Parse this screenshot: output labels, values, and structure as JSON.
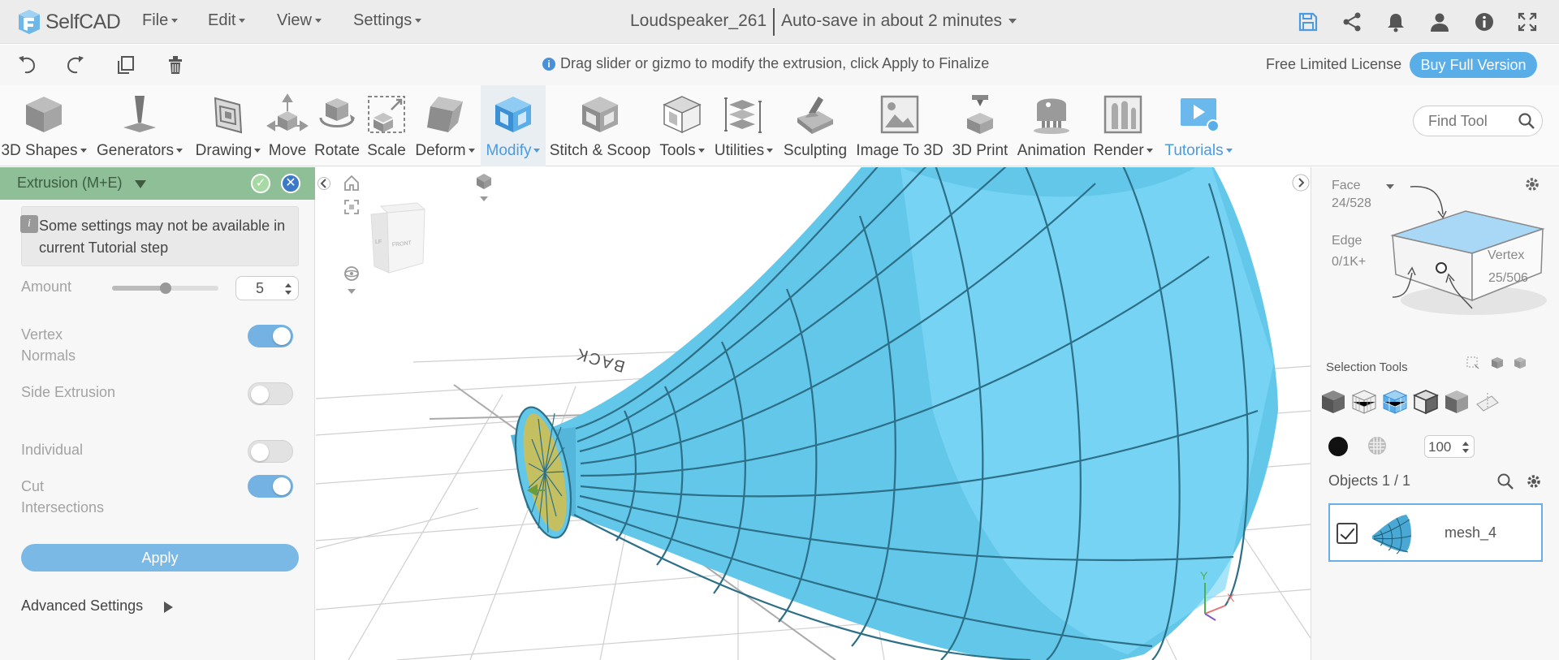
{
  "app": {
    "logo_text": "SelfCAD"
  },
  "menubar": {
    "file": "File",
    "edit": "Edit",
    "view": "View",
    "settings": "Settings",
    "doc_title": "Loudspeaker_261",
    "autosave": "Auto-save in about 2 minutes"
  },
  "bar2": {
    "hint": "Drag slider or gizmo to modify the extrusion, click Apply to Finalize",
    "license": "Free Limited License",
    "buy": "Buy Full Version"
  },
  "toolbar": {
    "tools": [
      {
        "label": "3D Shapes",
        "icon": "cube-icon",
        "dropdown": true
      },
      {
        "label": "Generators",
        "icon": "generator-icon",
        "dropdown": true
      },
      {
        "label": "Drawing",
        "icon": "drawing-icon",
        "dropdown": true
      },
      {
        "label": "Move",
        "icon": "move-icon",
        "dropdown": false
      },
      {
        "label": "Rotate",
        "icon": "rotate-icon",
        "dropdown": false
      },
      {
        "label": "Scale",
        "icon": "scale-icon",
        "dropdown": false
      },
      {
        "label": "Deform",
        "icon": "deform-icon",
        "dropdown": true
      },
      {
        "label": "Modify",
        "icon": "modify-icon",
        "dropdown": true,
        "active": true
      },
      {
        "label": "Stitch & Scoop",
        "icon": "stitch-scoop-icon",
        "dropdown": false
      },
      {
        "label": "Tools",
        "icon": "tools-icon",
        "dropdown": true
      },
      {
        "label": "Utilities",
        "icon": "utilities-icon",
        "dropdown": true
      },
      {
        "label": "Sculpting",
        "icon": "sculpting-icon",
        "dropdown": false
      },
      {
        "label": "Image To 3D",
        "icon": "image-to-3d-icon",
        "dropdown": false
      },
      {
        "label": "3D Print",
        "icon": "3d-print-icon",
        "dropdown": false
      },
      {
        "label": "Animation",
        "icon": "animation-icon",
        "dropdown": false
      },
      {
        "label": "Render",
        "icon": "render-icon",
        "dropdown": true
      },
      {
        "label": "Tutorials",
        "icon": "tutorials-icon",
        "dropdown": true,
        "blue": true
      }
    ],
    "find_placeholder": "Find Tool"
  },
  "left_panel": {
    "title": "Extrusion (M+E)",
    "note": "Some settings may not be available in current Tutorial step",
    "amount_label": "Amount",
    "amount_value": "5",
    "amount_slider_fraction": 0.5,
    "vertex_normals_label": "Vertex Normals",
    "vertex_normals_on": true,
    "side_extrusion_label": "Side Extrusion",
    "side_extrusion_on": false,
    "individual_label": "Individual",
    "individual_on": false,
    "cut_intersections_label": "Cut Intersections",
    "cut_intersections_on": true,
    "apply": "Apply",
    "advanced": "Advanced Settings"
  },
  "viewport": {
    "cube_front": "FRONT",
    "cube_left": "LF",
    "ground_label": "BACK",
    "axis_x": "X",
    "axis_y": "Y"
  },
  "right_panel": {
    "face_label": "Face",
    "face_count": "24/528",
    "edge_label": "Edge",
    "edge_count": "0/1K+",
    "vertex_label": "Vertex",
    "vertex_count": "25/506",
    "selection_tools": "Selection Tools",
    "number_value": "100",
    "objects_label": "Objects 1 / 1",
    "object_name": "mesh_4"
  },
  "colors": {
    "accent": "#5aaee8",
    "panel_header": "#8fbf97",
    "mesh": "#63c7ea",
    "mesh_edge": "#2c6f86",
    "mesh_face_selected": "#c4c062"
  }
}
